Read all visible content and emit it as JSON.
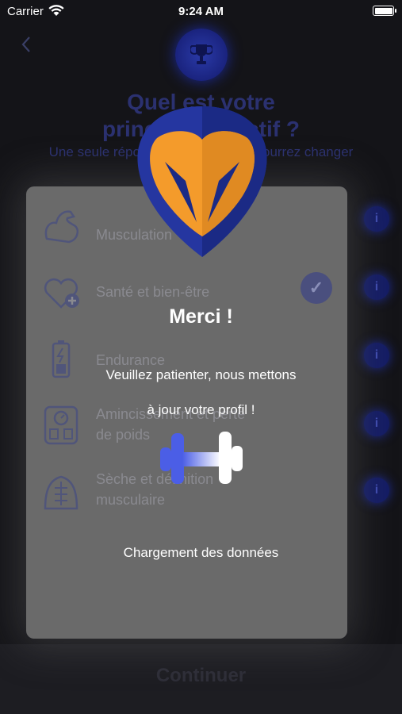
{
  "status_bar": {
    "carrier": "Carrier",
    "time": "9:24 AM",
    "wifi_icon": "wifi-icon",
    "battery_icon": "battery-icon"
  },
  "background_screen": {
    "back_icon": "chevron-left-icon",
    "header_icon": "trophy-icon",
    "title_line1": "Quel est votre",
    "title_line2": "principal objectif ?",
    "subtitle_line1": "Une seule réponse possible, vous pourrez changer",
    "subtitle_line2": "votre choix plus tard.",
    "info_label": "i",
    "options": [
      {
        "label": "Musculation",
        "icon": "flexed-arm-icon",
        "selected": false
      },
      {
        "label": "Santé et bien-être",
        "icon": "heart-plus-icon",
        "selected": true
      },
      {
        "label": "Endurance",
        "icon": "battery-energy-icon",
        "selected": false
      },
      {
        "label": "Amincissement et perte\nde poids",
        "icon": "scale-icon",
        "selected": false
      },
      {
        "label": "Sèche et définition\nmusculaire",
        "icon": "torso-icon",
        "selected": false
      }
    ],
    "check_icon": "checkmark-icon",
    "continue_label": "Continuer"
  },
  "modal": {
    "logo_icon": "shield-logo-icon",
    "title": "Merci !",
    "message_line1": "Veuillez patienter, nous mettons",
    "message_line2": "à jour votre profil !",
    "loader_icon": "dumbbell-icon",
    "loading_text": "Chargement des données"
  },
  "colors": {
    "brand_navy": "#2536a0",
    "brand_orange": "#f49b2b",
    "loader_blue": "#4b5ee6",
    "modal_bg": "#6a6a6a"
  }
}
